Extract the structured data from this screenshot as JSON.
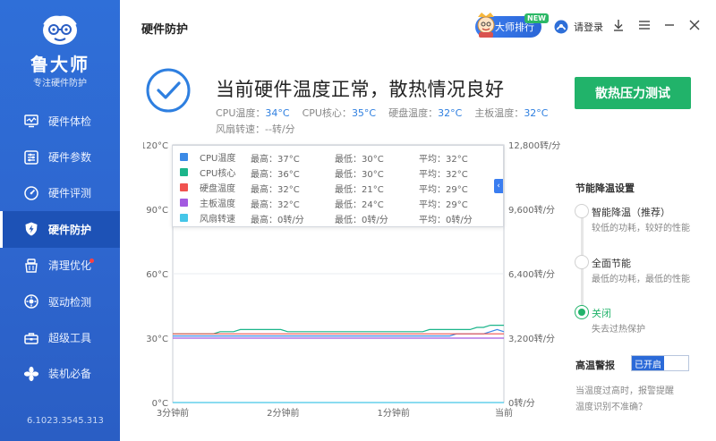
{
  "brand": {
    "name": "鲁大师",
    "subtitle": "专注硬件防护"
  },
  "sidebar": {
    "items": [
      {
        "label": "硬件体检",
        "icon": "monitor-icon"
      },
      {
        "label": "硬件参数",
        "icon": "sliders-icon"
      },
      {
        "label": "硬件评测",
        "icon": "speedometer-icon"
      },
      {
        "label": "硬件防护",
        "icon": "shield-bolt-icon",
        "active": true
      },
      {
        "label": "清理优化",
        "icon": "broom-icon",
        "dot": true
      },
      {
        "label": "驱动检测",
        "icon": "gear-circle-icon"
      },
      {
        "label": "超级工具",
        "icon": "toolbox-icon"
      },
      {
        "label": "装机必备",
        "icon": "fan-icon"
      }
    ],
    "version": "6.1023.3545.313"
  },
  "header": {
    "title": "硬件防护",
    "rank_label": "大师排行",
    "new_badge": "NEW",
    "login_label": "请登录"
  },
  "status": {
    "main": "当前硬件温度正常，散热情况良好",
    "cpu_temp_label": "CPU温度：",
    "cpu_temp": "34°C",
    "cpu_core_label": "CPU核心：",
    "cpu_core": "35°C",
    "disk_label": "硬盘温度：",
    "disk": "32°C",
    "board_label": "主板温度：",
    "board": "32°C",
    "fan_line": "风扇转速：--转/分",
    "stress_button": "散热压力测试"
  },
  "legend": {
    "rows": [
      {
        "name": "CPU温度",
        "color": "#3b8ae6",
        "max": "最高：37°C",
        "min": "最低：30°C",
        "avg": "平均：32°C"
      },
      {
        "name": "CPU核心",
        "color": "#1bb58a",
        "max": "最高：36°C",
        "min": "最低：30°C",
        "avg": "平均：32°C"
      },
      {
        "name": "硬盘温度",
        "color": "#f0524f",
        "max": "最高：32°C",
        "min": "最低：21°C",
        "avg": "平均：29°C"
      },
      {
        "name": "主板温度",
        "color": "#a35ae0",
        "max": "最高：32°C",
        "min": "最低：24°C",
        "avg": "平均：29°C"
      },
      {
        "name": "风扇转速",
        "color": "#45c6e8",
        "max": "最高：0转/分",
        "min": "最低：0转/分",
        "avg": "平均：0转/分"
      }
    ]
  },
  "chart_data": {
    "type": "line",
    "x_ticks": [
      "3分钟前",
      "2分钟前",
      "1分钟前",
      "当前"
    ],
    "y_left_ticks": [
      "0°C",
      "30°C",
      "60°C",
      "90°C",
      "120°C"
    ],
    "y_left_range": [
      0,
      120
    ],
    "y_right_ticks": [
      "0转/分",
      "3,200转/分",
      "6,400转/分",
      "9,600转/分",
      "12,800转/分"
    ],
    "y_right_range": [
      0,
      12800
    ],
    "series": [
      {
        "name": "CPU温度",
        "color": "#3b8ae6",
        "values": [
          31,
          31,
          31,
          31,
          31,
          31,
          31,
          31,
          31,
          31,
          31,
          31,
          31,
          31,
          31,
          31,
          31,
          31,
          31,
          31,
          31,
          31,
          31,
          31,
          31,
          31,
          31,
          31,
          31,
          31,
          31,
          31,
          31,
          31,
          31,
          31,
          31,
          31,
          31,
          31,
          31,
          31,
          32,
          32,
          32,
          32,
          32,
          33,
          34,
          33
        ]
      },
      {
        "name": "CPU核心",
        "color": "#1bb58a",
        "values": [
          32,
          32,
          32,
          32,
          32,
          32,
          32,
          33,
          33,
          33,
          34,
          34,
          34,
          34,
          34,
          34,
          34,
          33,
          33,
          33,
          33,
          33,
          33,
          33,
          33,
          33,
          33,
          33,
          33,
          33,
          33,
          33,
          33,
          33,
          33,
          33,
          33,
          33,
          34,
          34,
          34,
          34,
          34,
          34,
          34,
          35,
          35,
          36,
          36,
          36
        ]
      },
      {
        "name": "硬盘温度",
        "color": "#f0524f",
        "values": [
          32,
          32,
          32,
          32,
          32,
          32,
          32,
          32,
          32,
          32,
          32,
          32,
          32,
          32,
          32,
          32,
          32,
          32,
          32,
          32,
          32,
          32,
          32,
          32,
          32,
          32,
          32,
          32,
          32,
          32,
          32,
          32,
          32,
          32,
          32,
          32,
          32,
          32,
          32,
          32,
          32,
          32,
          32,
          32,
          32,
          32,
          32,
          32,
          32,
          32
        ]
      },
      {
        "name": "主板温度",
        "color": "#a35ae0",
        "values": [
          30,
          30,
          30,
          30,
          30,
          30,
          30,
          30,
          30,
          30,
          30,
          30,
          30,
          30,
          30,
          30,
          30,
          30,
          30,
          30,
          30,
          30,
          30,
          30,
          30,
          30,
          30,
          30,
          30,
          30,
          30,
          30,
          30,
          30,
          30,
          30,
          30,
          30,
          30,
          30,
          30,
          30,
          30,
          30,
          30,
          30,
          30,
          30,
          30,
          30
        ]
      },
      {
        "name": "风扇转速",
        "color": "#45c6e8",
        "values": [
          0,
          0,
          0,
          0,
          0,
          0,
          0,
          0,
          0,
          0,
          0,
          0,
          0,
          0,
          0,
          0,
          0,
          0,
          0,
          0,
          0,
          0,
          0,
          0,
          0,
          0,
          0,
          0,
          0,
          0,
          0,
          0,
          0,
          0,
          0,
          0,
          0,
          0,
          0,
          0,
          0,
          0,
          0,
          0,
          0,
          0,
          0,
          0,
          0,
          0
        ]
      }
    ]
  },
  "cooling": {
    "title": "节能降温设置",
    "options": [
      {
        "label": "智能降温（推荐）",
        "desc": "较低的功耗，较好的性能",
        "selected": false
      },
      {
        "label": "全面节能",
        "desc": "最低的功耗，最低的性能",
        "selected": false
      },
      {
        "label": "关闭",
        "desc": "失去过热保护",
        "selected": true
      }
    ]
  },
  "alert": {
    "title": "高温警报",
    "toggle_label": "已开启",
    "desc1": "当温度过高时，报警提醒",
    "desc2": "温度识别不准确？"
  },
  "colors": {
    "accent": "#2e6fd8",
    "green": "#21b36a",
    "value_blue": "#2e7fe0"
  }
}
